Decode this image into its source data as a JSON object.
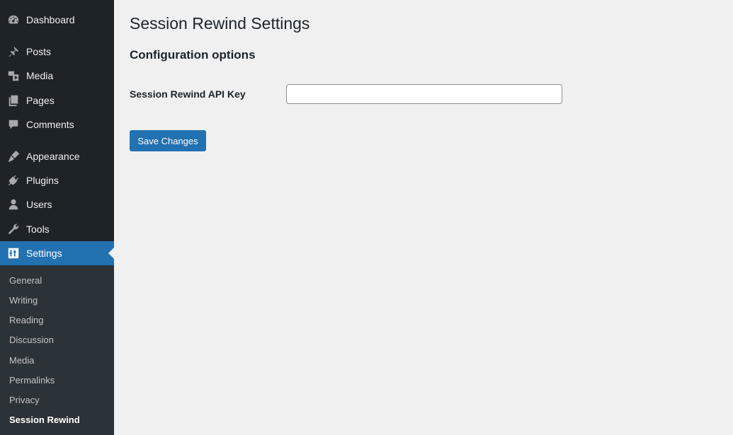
{
  "sidebar": {
    "items": [
      {
        "label": "Dashboard",
        "icon": "dashboard-icon"
      },
      {
        "label": "Posts",
        "icon": "pin-icon"
      },
      {
        "label": "Media",
        "icon": "media-icon"
      },
      {
        "label": "Pages",
        "icon": "pages-icon"
      },
      {
        "label": "Comments",
        "icon": "comment-icon"
      },
      {
        "label": "Appearance",
        "icon": "brush-icon"
      },
      {
        "label": "Plugins",
        "icon": "plugin-icon"
      },
      {
        "label": "Users",
        "icon": "user-icon"
      },
      {
        "label": "Tools",
        "icon": "wrench-icon"
      },
      {
        "label": "Settings",
        "icon": "settings-icon"
      }
    ],
    "submenu": [
      "General",
      "Writing",
      "Reading",
      "Discussion",
      "Media",
      "Permalinks",
      "Privacy",
      "Session Rewind"
    ]
  },
  "page": {
    "title": "Session Rewind Settings",
    "section_title": "Configuration options",
    "field_label": "Session Rewind API Key",
    "field_value": "",
    "save_label": "Save Changes"
  },
  "colors": {
    "sidebar_bg": "#1d2327",
    "submenu_bg": "#2c3338",
    "accent": "#2271b1",
    "page_bg": "#f0f0f1"
  }
}
